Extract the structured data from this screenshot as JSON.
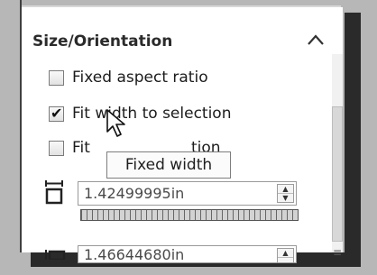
{
  "section": {
    "title": "Size/Orientation"
  },
  "options": [
    {
      "label": "Fixed aspect ratio",
      "checked": false
    },
    {
      "label": "Fit width to selection",
      "checked": true
    },
    {
      "label": "Fit height to selection",
      "checked": false
    }
  ],
  "options_visible_text": {
    "third_prefix": "Fit",
    "third_suffix": "tion"
  },
  "tooltip": {
    "text": "Fixed width"
  },
  "width_field": {
    "value": "1.42499995in"
  },
  "height_field": {
    "value": "1.46644680in"
  },
  "colors": {
    "accent": "#2b2b2b",
    "background": "#b7b7b7"
  }
}
